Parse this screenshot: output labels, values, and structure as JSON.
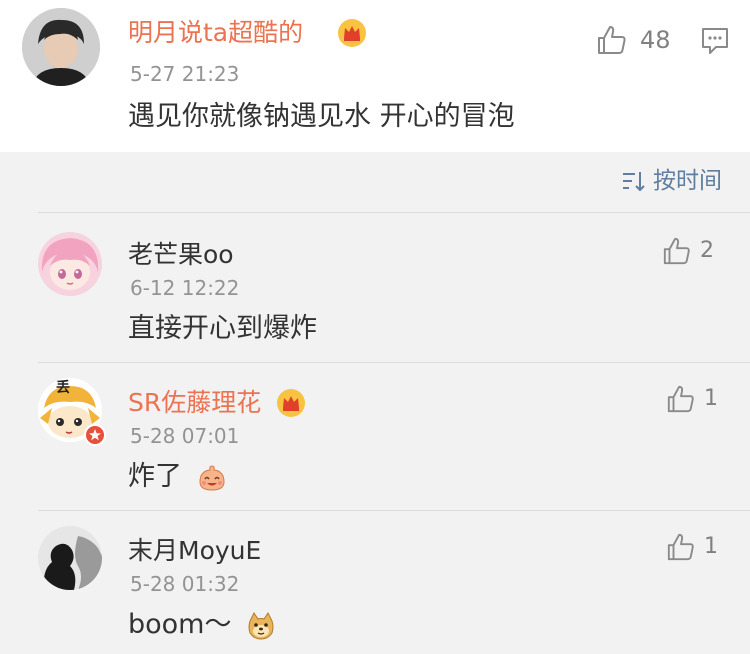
{
  "main": {
    "username": "明月说ta超酷的",
    "time": "5-27 21:23",
    "content": "遇见你就像钠遇见水 开心的冒泡",
    "likes": "48",
    "icons": {
      "like": "thumbs-up-icon",
      "comment": "comment-bubble-icon",
      "vip": "crown-badge-icon"
    }
  },
  "sort": {
    "label": "按时间",
    "icon": "sort-order-icon"
  },
  "replies": [
    {
      "username": "老芒果oo",
      "time": "6-12 12:22",
      "content": "直接开心到爆炸",
      "likes": "2",
      "vip": false
    },
    {
      "username": "SR佐藤理花",
      "time": "5-28 07:01",
      "content": "炸了",
      "likes": "1",
      "vip": true,
      "emoji": "smiling-blob-emoji",
      "avatar_label": "丢"
    },
    {
      "username": "末月MoyuE",
      "time": "5-28 01:32",
      "content": "boom～",
      "likes": "1",
      "vip": false,
      "emoji": "doge-emoji"
    }
  ],
  "colors": {
    "vip_name": "#eb7350",
    "link": "#5f7ea1",
    "muted": "#939393",
    "reply_bg": "#f2f2f2"
  }
}
